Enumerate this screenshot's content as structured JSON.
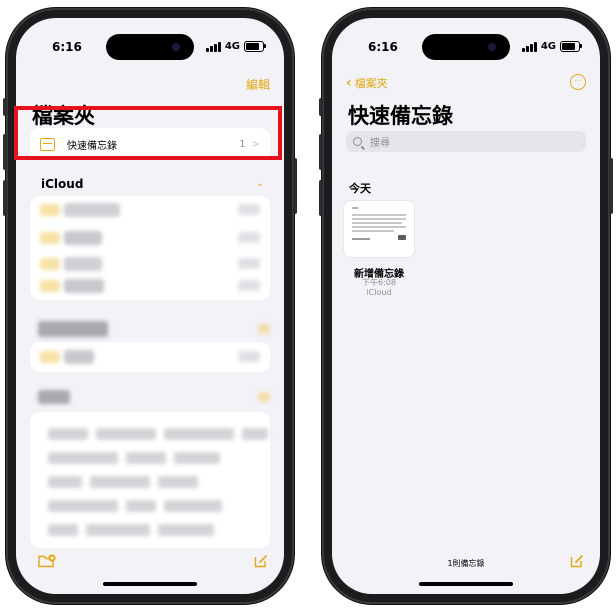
{
  "left_phone": {
    "status": {
      "time": "6:16",
      "network": "4G"
    },
    "edit_label": "編輯",
    "title": "檔案夾",
    "quick_notes": {
      "label": "快速備忘錄",
      "count": "1",
      "chevron": ">"
    },
    "icloud_label": "iCloud",
    "icloud_chevron": "⌄"
  },
  "right_phone": {
    "status": {
      "time": "6:16",
      "network": "4G"
    },
    "back_label": "檔案夾",
    "more_label": "···",
    "title": "快速備忘錄",
    "search_placeholder": "搜尋",
    "section_today": "今天",
    "note": {
      "title": "新增備忘錄",
      "time": "下午6:08",
      "folder": "iCloud"
    },
    "note_count": "1則備忘錄"
  },
  "colors": {
    "accent": "#e5a812",
    "highlight": "#e8101c",
    "background": "#f2f2f7"
  },
  "icons": {
    "new_folder": "folder-plus-icon",
    "compose": "compose-icon",
    "search": "search-icon",
    "more": "ellipsis-circle-icon"
  }
}
